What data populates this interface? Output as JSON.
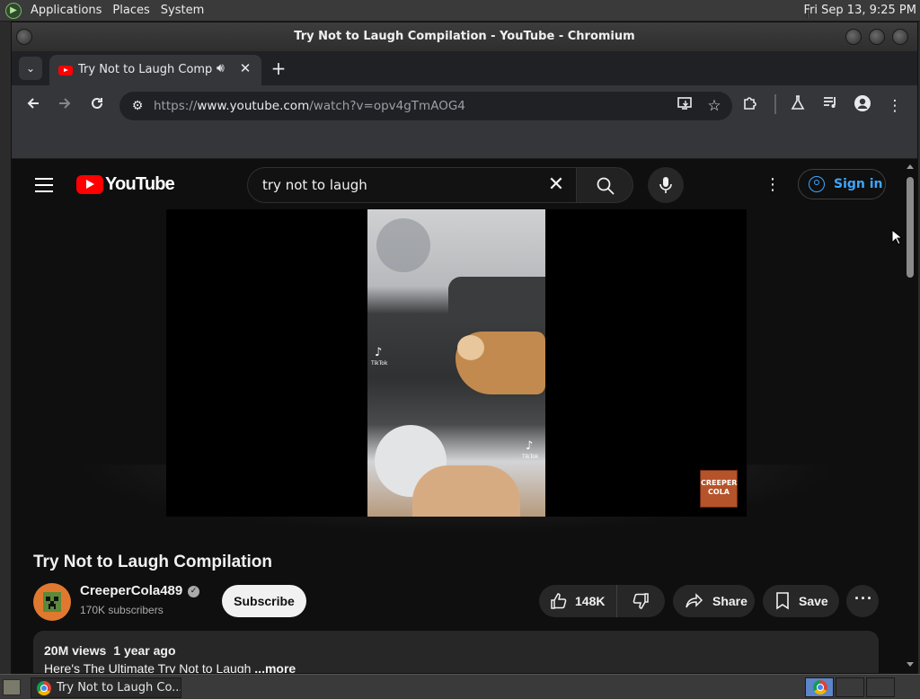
{
  "top_panel": {
    "menus": [
      "Applications",
      "Places",
      "System"
    ],
    "clock": "Fri Sep 13,  9:25 PM"
  },
  "window": {
    "title": "Try Not to Laugh Compilation - YouTube - Chromium"
  },
  "browser": {
    "tab": {
      "title": "Try Not to Laugh Compila",
      "audio_icon": "speaker-icon"
    },
    "url": {
      "scheme": "https://",
      "host": "www.youtube.com",
      "path": "/watch?v=opv4gTmAOG4"
    }
  },
  "youtube": {
    "logo_text": "YouTube",
    "search_query": "try not to laugh",
    "sign_in_label": "Sign in",
    "video": {
      "title": "Try Not to Laugh Compilation",
      "channel": "CreeperCola489",
      "subscribers": "170K subscribers",
      "subscribe_label": "Subscribe",
      "likes": "148K",
      "share_label": "Share",
      "save_label": "Save",
      "views": "20M views",
      "age": "1 year ago",
      "description": "Here's The Ultimate Try Not to Laugh ",
      "more_label": "...more",
      "watermark": "CREEPER COLA",
      "tiktok_label": "TikTok"
    }
  },
  "taskbar": {
    "item_label": "Try Not to Laugh Co..."
  },
  "colors": {
    "youtube_red": "#ff0000",
    "link_blue": "#3ea6ff",
    "page_bg": "#0f0f0f",
    "chrome_toolbar": "#35363a"
  }
}
